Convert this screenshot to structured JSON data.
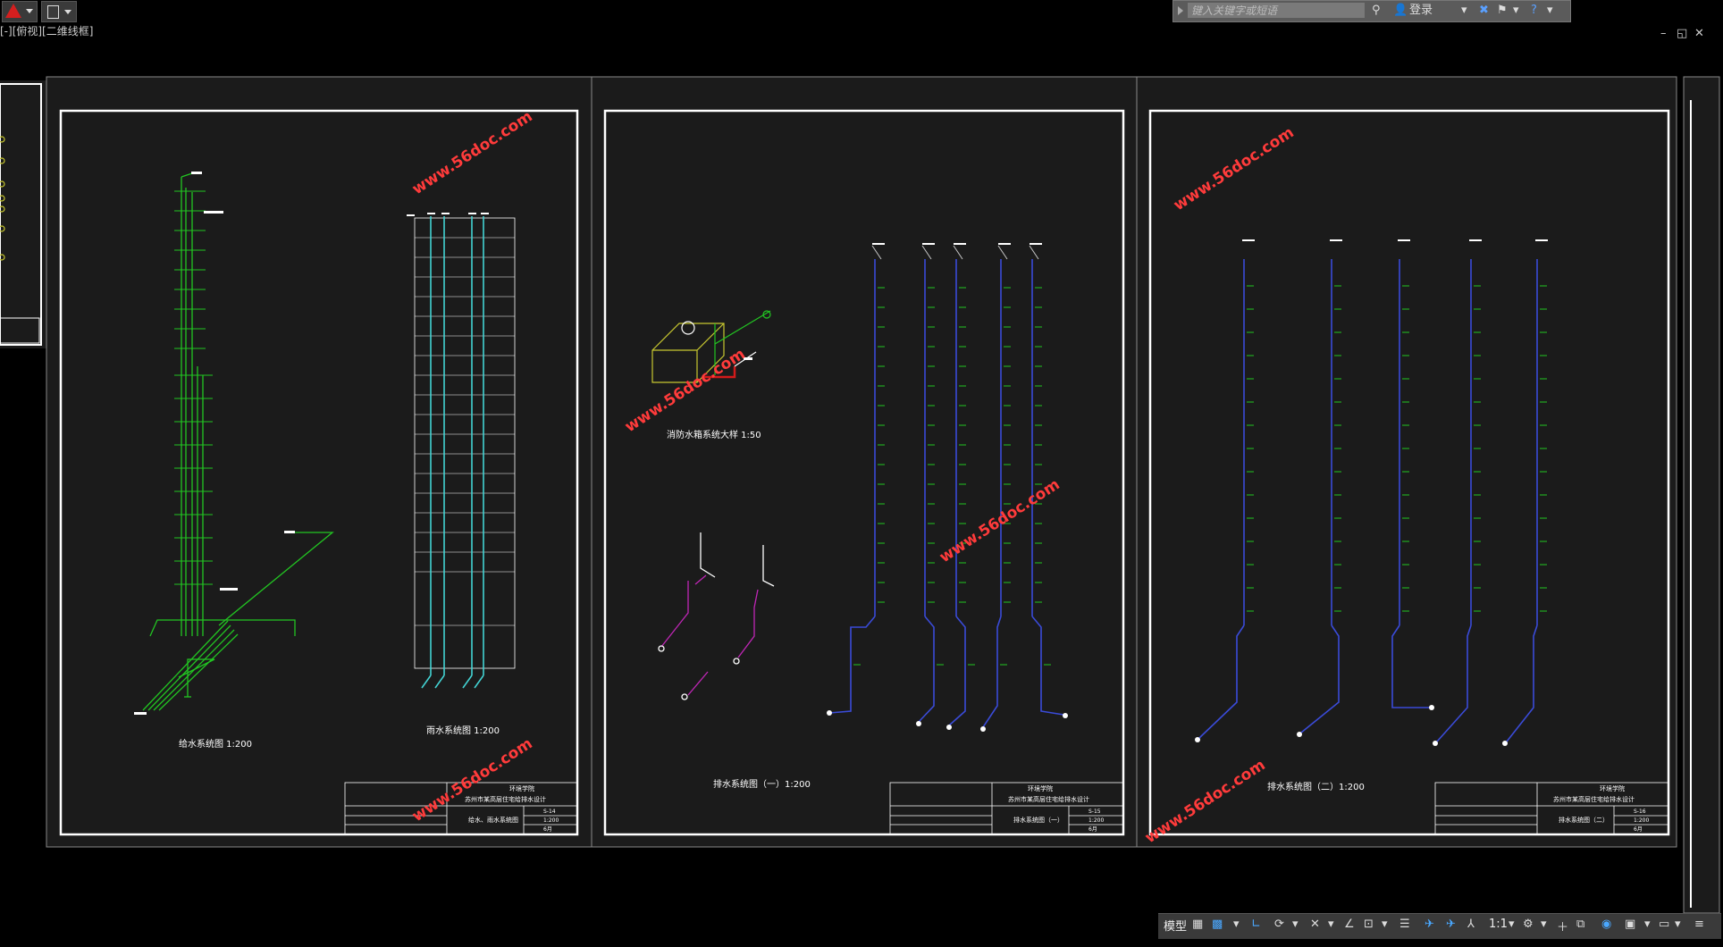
{
  "app": {
    "logo_icon": "autocad-logo-icon",
    "quick_access_icon": "document-icon"
  },
  "search": {
    "placeholder": "键入关键字或短语"
  },
  "account": {
    "login_label": "登录"
  },
  "document_tab": {
    "label": "[-][俯视][二维线框]"
  },
  "window_controls": {
    "minimize": "–",
    "restore": "◱",
    "close": "✕"
  },
  "sheets": [
    {
      "watermark": "www.56doc.com",
      "caption_left": "给水系统图 1:200",
      "caption_right": "雨水系统图 1:200",
      "title_block": {
        "school": "环境学院",
        "project": "苏州市某高层住宅给排水设计",
        "drawing": "给水、雨水系统图",
        "drawing_no": "S-14",
        "scale": "1:200",
        "date": "6月"
      }
    },
    {
      "watermark": "www.56doc.com",
      "caption_tank": "消防水箱系统大样 1:50",
      "caption_main": "排水系统图（一）1:200",
      "title_block": {
        "school": "环境学院",
        "project": "苏州市某高层住宅给排水设计",
        "drawing": "排水系统图（一）",
        "drawing_no": "S-15",
        "scale": "1:200",
        "date": "6月"
      }
    },
    {
      "watermark": "www.56doc.com",
      "caption_main": "排水系统图（二）1:200",
      "title_block": {
        "school": "环境学院",
        "project": "苏州市某高层住宅给排水设计",
        "drawing": "排水系统图（二）",
        "drawing_no": "S-16",
        "scale": "1:200",
        "date": "6月"
      }
    }
  ],
  "statusbar": {
    "model_label": "模型",
    "scale_label": "1:1"
  },
  "colors": {
    "green": "#22c522",
    "cyan": "#43d4d4",
    "blue": "#3a4bd8",
    "magenta": "#c026b6",
    "yellow": "#c8c830",
    "red": "#d21a1a",
    "watermark": "#ff3b3b",
    "paper": "#1b1b1b"
  }
}
